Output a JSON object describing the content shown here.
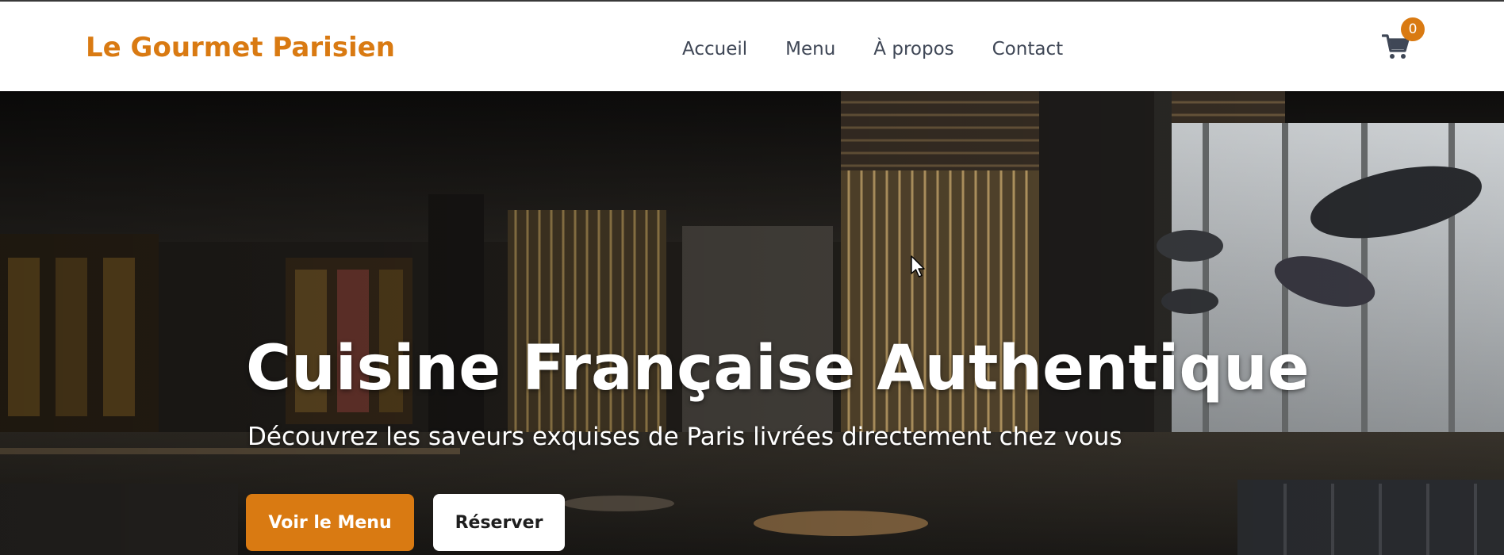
{
  "header": {
    "logo": "Le Gourmet Parisien",
    "nav": [
      "Accueil",
      "Menu",
      "À propos",
      "Contact"
    ],
    "cart": {
      "icon": "cart-icon",
      "count": "0"
    }
  },
  "hero": {
    "title": "Cuisine Française Authentique",
    "subtitle": "Découvrez les saveurs exquises de Paris livrées directement chez vous",
    "primary_button": "Voir le Menu",
    "secondary_button": "Réserver"
  },
  "colors": {
    "accent": "#d97a12",
    "nav_text": "#3f4756",
    "header_bg": "#ffffff"
  }
}
